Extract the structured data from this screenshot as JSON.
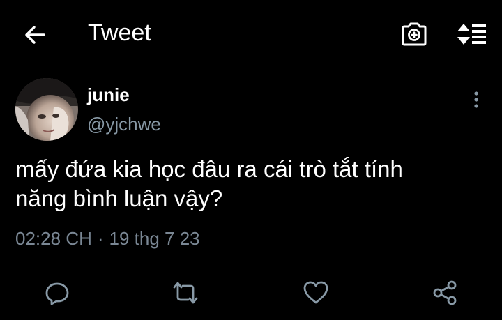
{
  "header": {
    "title": "Tweet",
    "back_icon": "arrow-left-icon",
    "camera_icon": "camera-icon",
    "sort_icon": "sort-icon"
  },
  "tweet": {
    "author": {
      "display_name": "junie",
      "handle": "@yjchwe"
    },
    "text_line1": "mấy đứa kia học đâu ra cái trò tắt tính",
    "text_line2": "năng bình luận vậy?",
    "time": "02:28 CH",
    "separator": "·",
    "date": "19 thg 7 23"
  },
  "actions": {
    "reply_icon": "reply-icon",
    "retweet_icon": "retweet-icon",
    "like_icon": "heart-icon",
    "share_icon": "share-icon"
  },
  "colors": {
    "background": "#000000",
    "text": "#ffffff",
    "secondary_text": "#8899a6",
    "icon": "#8899a6"
  }
}
